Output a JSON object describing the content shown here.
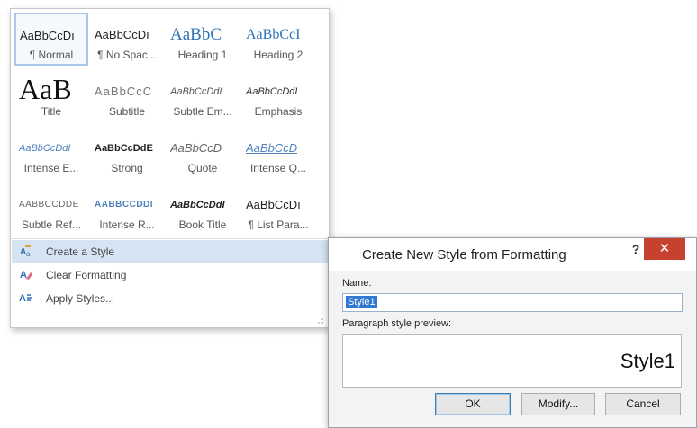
{
  "gallery": {
    "styles": [
      {
        "sample": "AaBbCcDı",
        "label": "¶ Normal"
      },
      {
        "sample": "AaBbCcDı",
        "label": "¶ No Spac..."
      },
      {
        "sample": "AaBbC",
        "label": "Heading 1"
      },
      {
        "sample": "AaBbCcI",
        "label": "Heading 2"
      },
      {
        "sample": "AaB",
        "label": "Title"
      },
      {
        "sample": "AaBbCcC",
        "label": "Subtitle"
      },
      {
        "sample": "AaBbCcDdI",
        "label": "Subtle Em..."
      },
      {
        "sample": "AaBbCcDdI",
        "label": "Emphasis"
      },
      {
        "sample": "AaBbCcDdI",
        "label": "Intense E..."
      },
      {
        "sample": "AaBbCcDdE",
        "label": "Strong"
      },
      {
        "sample": "AaBbCcD",
        "label": "Quote"
      },
      {
        "sample": "AaBbCcD",
        "label": "Intense Q..."
      },
      {
        "sample": "AABBCCDDE",
        "label": "Subtle Ref..."
      },
      {
        "sample": "AABBCCDDI",
        "label": "Intense R..."
      },
      {
        "sample": "AaBbCcDdI",
        "label": "Book Title"
      },
      {
        "sample": "AaBbCcDı",
        "label": "¶ List Para..."
      }
    ],
    "commands": {
      "create": "Create a Style",
      "clear": "Clear Formatting",
      "apply": "Apply Styles..."
    }
  },
  "dialog": {
    "title": "Create New Style from Formatting",
    "help": "?",
    "close": "✕",
    "name_label": "Name:",
    "name_value": "Style1",
    "preview_label": "Paragraph style preview:",
    "preview_text": "Style1",
    "ok": "OK",
    "modify": "Modify...",
    "cancel": "Cancel"
  },
  "colors": {
    "accent": "#2e74b5",
    "hover": "#d5e3f3",
    "close_button": "#c7412f"
  }
}
